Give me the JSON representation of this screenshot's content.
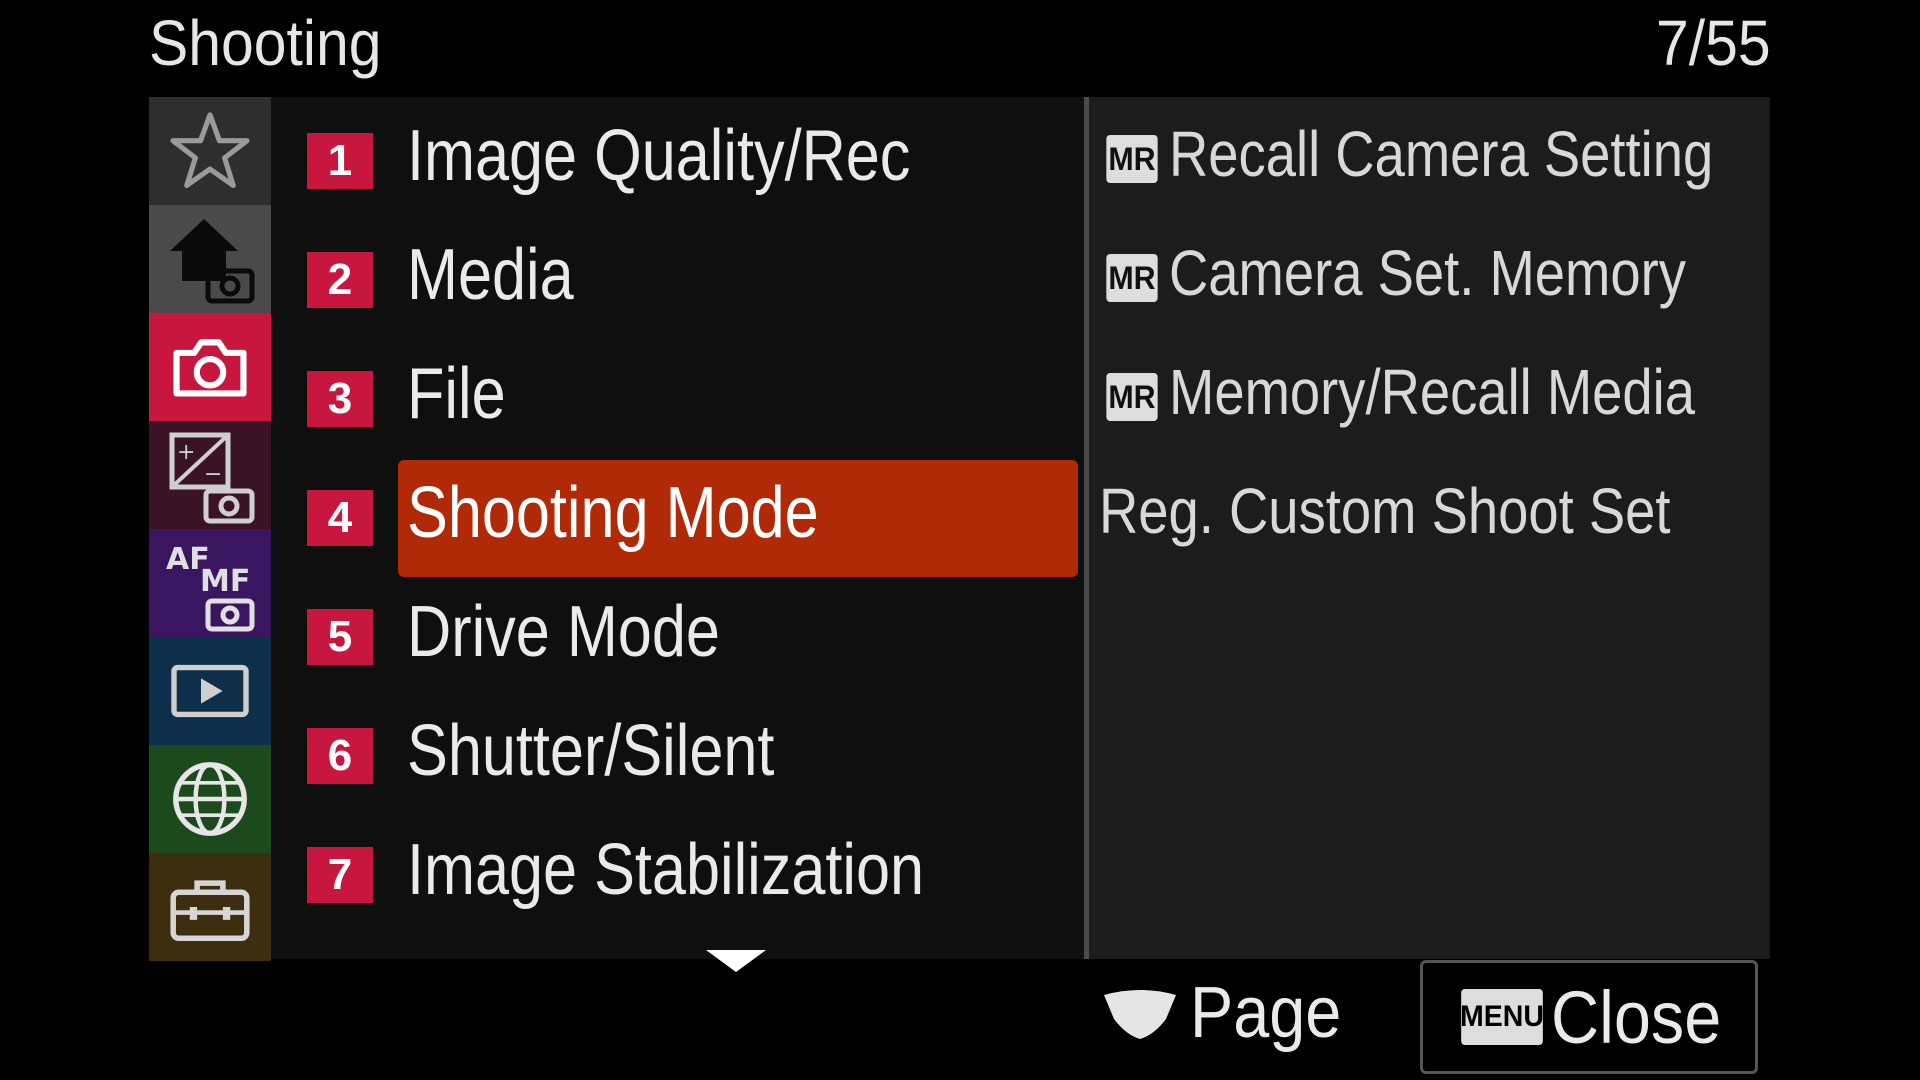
{
  "header": {
    "title": "Shooting",
    "page_counter": "7/55"
  },
  "tabs": [
    {
      "name": "star-icon",
      "color": "#2e2e2e"
    },
    {
      "name": "home-camera-icon",
      "color": "#4a4a4a"
    },
    {
      "name": "camera-icon",
      "color": "#c8173f",
      "active": true
    },
    {
      "name": "exposure-camera-icon",
      "color": "#3a1426"
    },
    {
      "name": "af-mf-camera-icon",
      "color": "#3a1660"
    },
    {
      "name": "playback-icon",
      "color": "#0d2f4a"
    },
    {
      "name": "globe-icon",
      "color": "#1c4a1c"
    },
    {
      "name": "toolbox-icon",
      "color": "#3c2e0f"
    }
  ],
  "menu_items": [
    {
      "number": "1",
      "label": "Image Quality/Rec"
    },
    {
      "number": "2",
      "label": "Media"
    },
    {
      "number": "3",
      "label": "File"
    },
    {
      "number": "4",
      "label": "Shooting Mode",
      "selected": true
    },
    {
      "number": "5",
      "label": "Drive Mode"
    },
    {
      "number": "6",
      "label": "Shutter/Silent"
    },
    {
      "number": "7",
      "label": "Image Stabilization"
    }
  ],
  "submenu_items": [
    {
      "icon_text": "MR",
      "label": "Recall Camera Setting"
    },
    {
      "icon_text": "MR",
      "label": "Camera Set. Memory"
    },
    {
      "icon_text": "MR",
      "label": "Memory/Recall Media"
    },
    {
      "icon_text": "",
      "label": "Reg. Custom Shoot Set"
    }
  ],
  "footer": {
    "page_label": "Page",
    "menu_badge": "MENU",
    "close_label": "Close"
  }
}
